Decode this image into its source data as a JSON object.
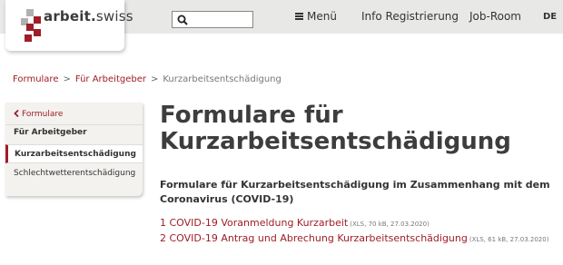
{
  "header": {
    "logo": {
      "brand": "arbeit.",
      "suffix": "swiss"
    },
    "search": {
      "placeholder": "",
      "value": ""
    },
    "nav": [
      {
        "label": "Menü",
        "icon": "menu-icon"
      },
      {
        "label": "Info Registrierung"
      },
      {
        "label": "Job-Room"
      }
    ],
    "language": "DE",
    "colors": {
      "header_bg": "#e8e8e6",
      "accent": "#9e1d27"
    }
  },
  "breadcrumb": {
    "items": [
      {
        "label": "Formulare"
      },
      {
        "label": "Für Arbeitgeber"
      },
      {
        "label": "Kurzarbeitsentschädigung"
      }
    ],
    "separator": ">"
  },
  "sidebar": {
    "back_label": "Formulare",
    "back_icon": "chevron-left-icon",
    "parent_label": "Für Arbeitgeber",
    "active_label": "Kurzarbeitsentschädigung",
    "child_label": "Schlechtwetterentschädigung"
  },
  "main": {
    "title": "Formulare für Kurzarbeitsentschädigung",
    "subtitle": "Formulare für Kurzarbeitsentschädigung im Zusammenhang mit dem Coronavirus (COVID-19)",
    "documents": [
      {
        "label": "1 COVID-19 Voranmeldung Kurzarbeit",
        "meta": "(XLS, 70 kB, 27.03.2020)"
      },
      {
        "label": "2 COVID-19 Antrag und Abrechung Kurzarbeitsentschädigung",
        "meta": "(XLS, 61 kB, 27.03.2020)"
      }
    ]
  }
}
